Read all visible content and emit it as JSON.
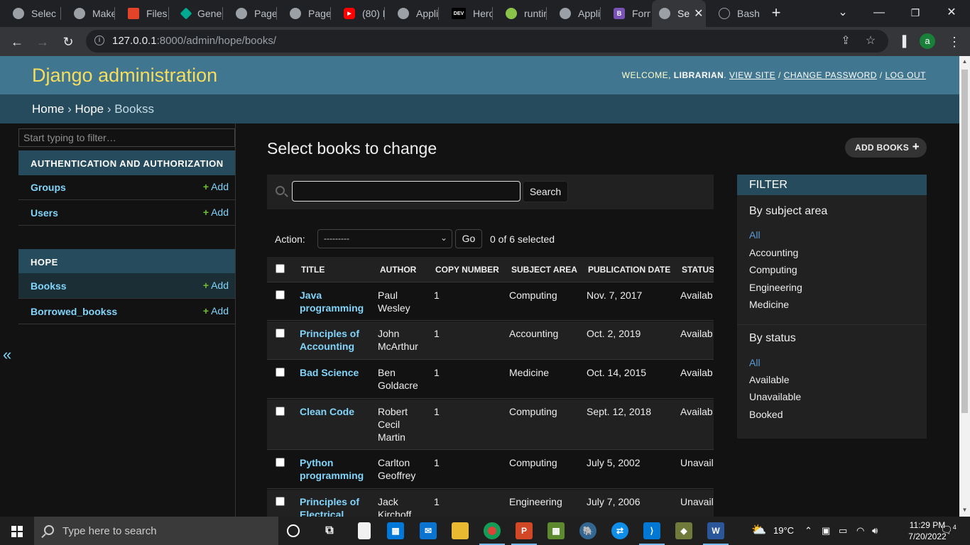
{
  "browser": {
    "tabs": [
      {
        "title": "Selec",
        "icon": "globe-icon",
        "color": "#9aa0a6"
      },
      {
        "title": "Make",
        "icon": "globe-icon",
        "color": "#9aa0a6"
      },
      {
        "title": "Files",
        "icon": "gitlab-icon",
        "color": "#e24329"
      },
      {
        "title": "Gene",
        "icon": "diamond-icon",
        "color": "#00a98f"
      },
      {
        "title": "Page",
        "icon": "globe-icon",
        "color": "#9aa0a6"
      },
      {
        "title": "Page",
        "icon": "globe-icon",
        "color": "#9aa0a6"
      },
      {
        "title": "(80) H",
        "icon": "youtube-icon",
        "color": "#ff0000"
      },
      {
        "title": "Appli",
        "icon": "globe-icon",
        "color": "#9aa0a6"
      },
      {
        "title": "Herol",
        "icon": "dev-icon",
        "color": "#000000"
      },
      {
        "title": "runtir",
        "icon": "spark-icon",
        "color": "#8bc34a"
      },
      {
        "title": "Appli",
        "icon": "globe-icon",
        "color": "#9aa0a6"
      },
      {
        "title": "Form",
        "icon": "bootstrap-icon",
        "color": "#7952b3"
      },
      {
        "title": "Se",
        "icon": "globe-icon",
        "color": "#9aa0a6"
      },
      {
        "title": "Bash",
        "icon": "bash-icon",
        "color": "#202124"
      }
    ],
    "dev_badge": "DEV",
    "bootstrap_badge": "B",
    "url_host": "127.0.0.1",
    "url_rest": ":8000/admin/hope/books/",
    "profile_initial": "a"
  },
  "admin": {
    "brand": "Django administration",
    "welcome": "WELCOME, ",
    "username": "LIBRARIAN",
    "view_site": "VIEW SITE",
    "change_password": "CHANGE PASSWORD",
    "log_out": "LOG OUT",
    "crumbs": {
      "home": "Home",
      "app": "Hope",
      "model": "Bookss"
    },
    "nav_filter_placeholder": "Start typing to filter…",
    "auth_caption": "AUTHENTICATION AND AUTHORIZATION",
    "groups": "Groups",
    "users": "Users",
    "hope_caption": "HOPE",
    "bookss": "Bookss",
    "borrowed": "Borrowed_bookss",
    "add": "Add",
    "page_title": "Select books to change",
    "add_books": "ADD BOOKS",
    "search_value": "",
    "search_button": "Search",
    "action_label": "Action:",
    "action_selected": "---------",
    "go": "Go",
    "selected_count": "0 of 6 selected",
    "columns": [
      "TITLE",
      "AUTHOR",
      "COPY NUMBER",
      "SUBJECT AREA",
      "PUBLICATION DATE",
      "STATUS"
    ],
    "rows": [
      {
        "title": "Java programming",
        "author": "Paul Wesley",
        "copy": "1",
        "subject": "Computing",
        "date": "Nov. 7, 2017",
        "status": "Availab"
      },
      {
        "title": "Principles of Accounting",
        "author": "John McArthur",
        "copy": "1",
        "subject": "Accounting",
        "date": "Oct. 2, 2019",
        "status": "Availab"
      },
      {
        "title": "Bad Science",
        "author": "Ben Goldacre",
        "copy": "1",
        "subject": "Medicine",
        "date": "Oct. 14, 2015",
        "status": "Availab"
      },
      {
        "title": "Clean Code",
        "author": "Robert Cecil Martin",
        "copy": "1",
        "subject": "Computing",
        "date": "Sept. 12, 2018",
        "status": "Availab"
      },
      {
        "title": "Python programming",
        "author": "Carlton Geoffrey",
        "copy": "1",
        "subject": "Computing",
        "date": "July 5, 2002",
        "status": "Unavail"
      },
      {
        "title": "Principles of Electrical",
        "author": "Jack Kirchoff",
        "copy": "1",
        "subject": "Engineering",
        "date": "July 7, 2006",
        "status": "Unavail"
      }
    ],
    "filter": {
      "caption": "FILTER",
      "subject_heading": "By subject area",
      "subject_items": [
        "All",
        "Accounting",
        "Computing",
        "Engineering",
        "Medicine"
      ],
      "status_heading": "By status",
      "status_items": [
        "All",
        "Available",
        "Unavailable",
        "Booked"
      ]
    }
  },
  "taskbar": {
    "search_placeholder": "Type here to search",
    "temperature": "19°C",
    "time": "11:29 PM",
    "date": "7/20/2022",
    "notifications": "4",
    "apps": [
      {
        "name": "cortana-icon"
      },
      {
        "name": "task-view-icon"
      },
      {
        "name": "file-icon"
      },
      {
        "name": "store-icon"
      },
      {
        "name": "mail-icon"
      },
      {
        "name": "explorer-icon"
      },
      {
        "name": "chrome-icon"
      },
      {
        "name": "powerpoint-icon"
      },
      {
        "name": "minecraft-icon"
      },
      {
        "name": "postgres-icon"
      },
      {
        "name": "teamviewer-icon"
      },
      {
        "name": "vscode-icon"
      },
      {
        "name": "git-icon"
      },
      {
        "name": "word-icon"
      }
    ]
  }
}
